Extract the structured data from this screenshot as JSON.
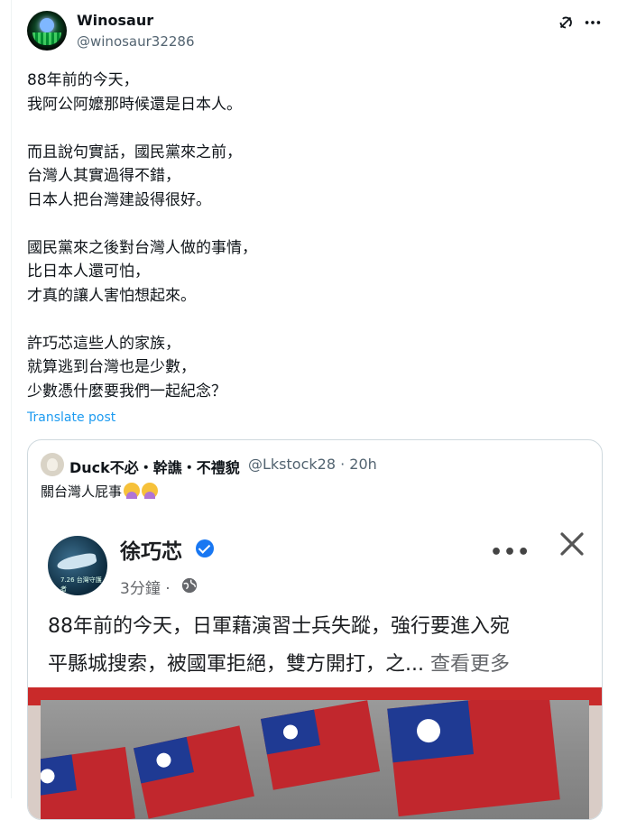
{
  "author": {
    "name": "Winosaur",
    "handle": "@winosaur32286"
  },
  "icons": [
    "grok-icon",
    "more-icon"
  ],
  "tweet": {
    "text": "88年前的今天，\n我阿公阿嬤那時候還是日本人。\n\n而且說句實話，國民黨來之前，\n台灣人其實過得不錯，\n日本人把台灣建設得很好。\n\n國民黨來之後對台灣人做的事情，\n比日本人還可怕，\n才真的讓人害怕想起來。\n\n許巧芯這些人的家族，\n就算逃到台灣也是少數，\n少數憑什麼要我們一起紀念？",
    "translate_label": "Translate post"
  },
  "quote": {
    "name": "Duck不必・幹譙・不禮貌",
    "handle_time": "@Lkstock28 · 20h",
    "text": "關台灣人屁事",
    "emoji_count": 2,
    "embedded_post": {
      "name": "徐巧芯",
      "time": "3分鐘 · ",
      "text": "88年前的今天，日軍藉演習士兵失蹤，強行要進入宛\n平縣城搜索，被國軍拒絕，雙方開打，之... ",
      "see_more": "查看更多",
      "avatar_caption": "7.26 台灣守護者"
    }
  },
  "colors": {
    "link": "#1d9bf0",
    "secondary": "#536471",
    "verified": "#1877f2",
    "flag_red": "#c1272d",
    "flag_blue": "#1f3a93"
  }
}
